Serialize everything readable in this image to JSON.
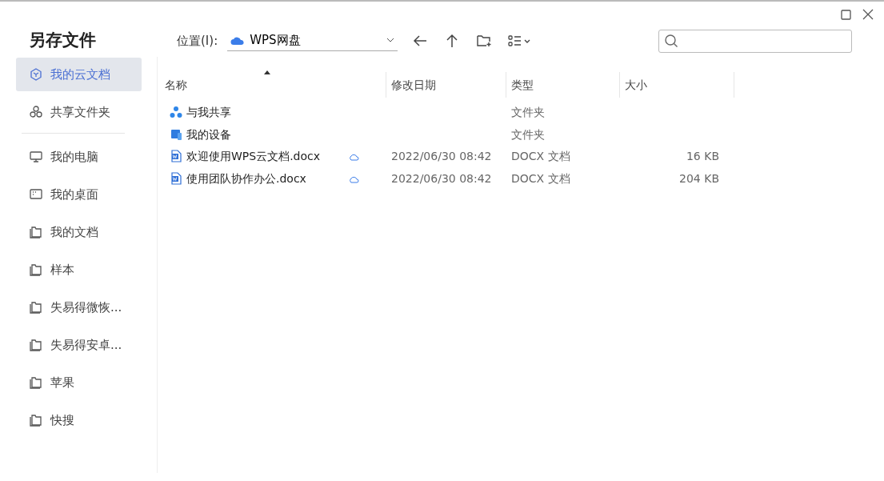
{
  "window": {
    "title": "另存文件"
  },
  "sidebar": {
    "cloud_items": [
      {
        "label": "我的云文档",
        "kind": "cube",
        "selected": true
      },
      {
        "label": "共享文件夹",
        "kind": "share",
        "selected": false
      }
    ],
    "places": [
      {
        "label": "我的电脑",
        "kind": "monitor",
        "selected": false
      },
      {
        "label": "我的桌面",
        "kind": "desktop",
        "selected": false
      },
      {
        "label": "我的文档",
        "kind": "folder",
        "selected": false
      },
      {
        "label": "样本",
        "kind": "folder",
        "selected": false
      },
      {
        "label": "失易得微恢...",
        "kind": "folder",
        "selected": false
      },
      {
        "label": "失易得安卓...",
        "kind": "folder",
        "selected": false
      },
      {
        "label": "苹果",
        "kind": "folder",
        "selected": false
      },
      {
        "label": "快搜",
        "kind": "folder",
        "selected": false
      }
    ]
  },
  "location": {
    "label": "位置(I):",
    "value": "WPS网盘"
  },
  "table": {
    "columns": [
      {
        "label": "名称",
        "sorted": true
      },
      {
        "label": "修改日期",
        "sorted": false
      },
      {
        "label": "类型",
        "sorted": false
      },
      {
        "label": "大小",
        "sorted": false
      }
    ],
    "rows": [
      {
        "kind": "shared",
        "name": "与我共享",
        "date": "",
        "type": "文件夹",
        "size": "",
        "cloud": false
      },
      {
        "kind": "device",
        "name": "我的设备",
        "date": "",
        "type": "文件夹",
        "size": "",
        "cloud": false
      },
      {
        "kind": "docx",
        "name": "欢迎使用WPS云文档.docx",
        "date": "2022/06/30 08:42",
        "type": "DOCX 文档",
        "size": "16 KB",
        "cloud": true
      },
      {
        "kind": "docx",
        "name": "使用团队协作办公.docx",
        "date": "2022/06/30 08:42",
        "type": "DOCX 文档",
        "size": "204 KB",
        "cloud": true
      }
    ]
  }
}
